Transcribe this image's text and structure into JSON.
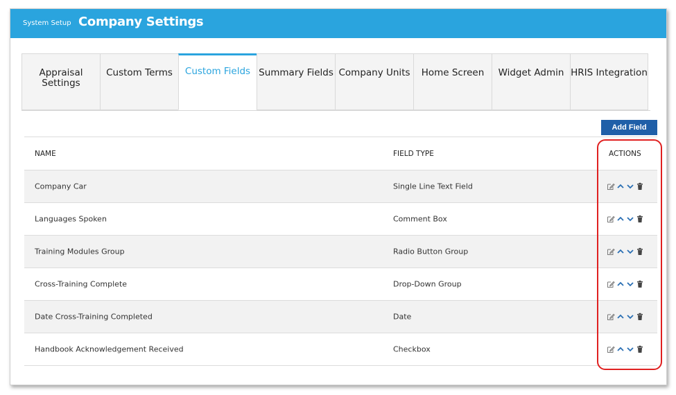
{
  "header": {
    "crumb": "System Setup",
    "title": "Company Settings"
  },
  "tabs": [
    {
      "label": "Appraisal\nSettings",
      "active": false
    },
    {
      "label": "Custom Terms",
      "active": false
    },
    {
      "label": "Custom Fields",
      "active": true
    },
    {
      "label": "Summary Fields",
      "active": false
    },
    {
      "label": "Company Units",
      "active": false
    },
    {
      "label": "Home Screen",
      "active": false
    },
    {
      "label": "Widget Admin",
      "active": false
    },
    {
      "label": "HRIS Integration",
      "active": false
    }
  ],
  "toolbar": {
    "add_label": "Add Field"
  },
  "table": {
    "columns": {
      "name": "NAME",
      "type": "FIELD TYPE",
      "actions": "ACTIONS"
    },
    "rows": [
      {
        "name": "Company Car",
        "type": "Single Line Text Field"
      },
      {
        "name": "Languages Spoken",
        "type": "Comment Box"
      },
      {
        "name": "Training Modules Group",
        "type": "Radio Button Group"
      },
      {
        "name": "Cross-Training Complete",
        "type": "Drop-Down Group"
      },
      {
        "name": "Date Cross-Training Completed",
        "type": "Date"
      },
      {
        "name": "Handbook Acknowledgement Received",
        "type": "Checkbox"
      }
    ]
  },
  "icons": {
    "edit": "edit-icon",
    "up": "chevron-up-icon",
    "down": "chevron-down-icon",
    "delete": "trash-icon"
  },
  "colors": {
    "header": "#2aa4de",
    "button": "#1f5fa8",
    "icon": "#2a6fb3",
    "highlight": "#e02020"
  }
}
